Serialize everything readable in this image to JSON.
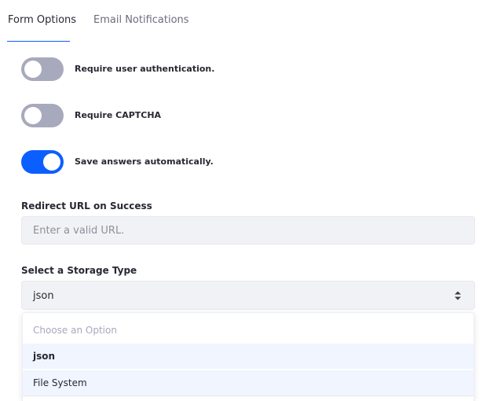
{
  "tabs": {
    "form_options": "Form Options",
    "email_notifications": "Email Notifications"
  },
  "toggles": {
    "require_auth": {
      "label": "Require user authentication.",
      "checked": false
    },
    "require_captcha": {
      "label": "Require CAPTCHA",
      "checked": false
    },
    "save_answers": {
      "label": "Save answers automatically.",
      "checked": true
    }
  },
  "redirect": {
    "label": "Redirect URL on Success",
    "placeholder": "Enter a valid URL.",
    "value": ""
  },
  "storage": {
    "label": "Select a Storage Type",
    "selected": "json",
    "options_placeholder": "Choose an Option",
    "options": [
      "json",
      "File System"
    ]
  },
  "colors": {
    "accent": "#0b5fff",
    "toggle_off": "#a7a9bc",
    "input_bg": "#f1f2f5",
    "highlight": "#f0f5ff"
  }
}
